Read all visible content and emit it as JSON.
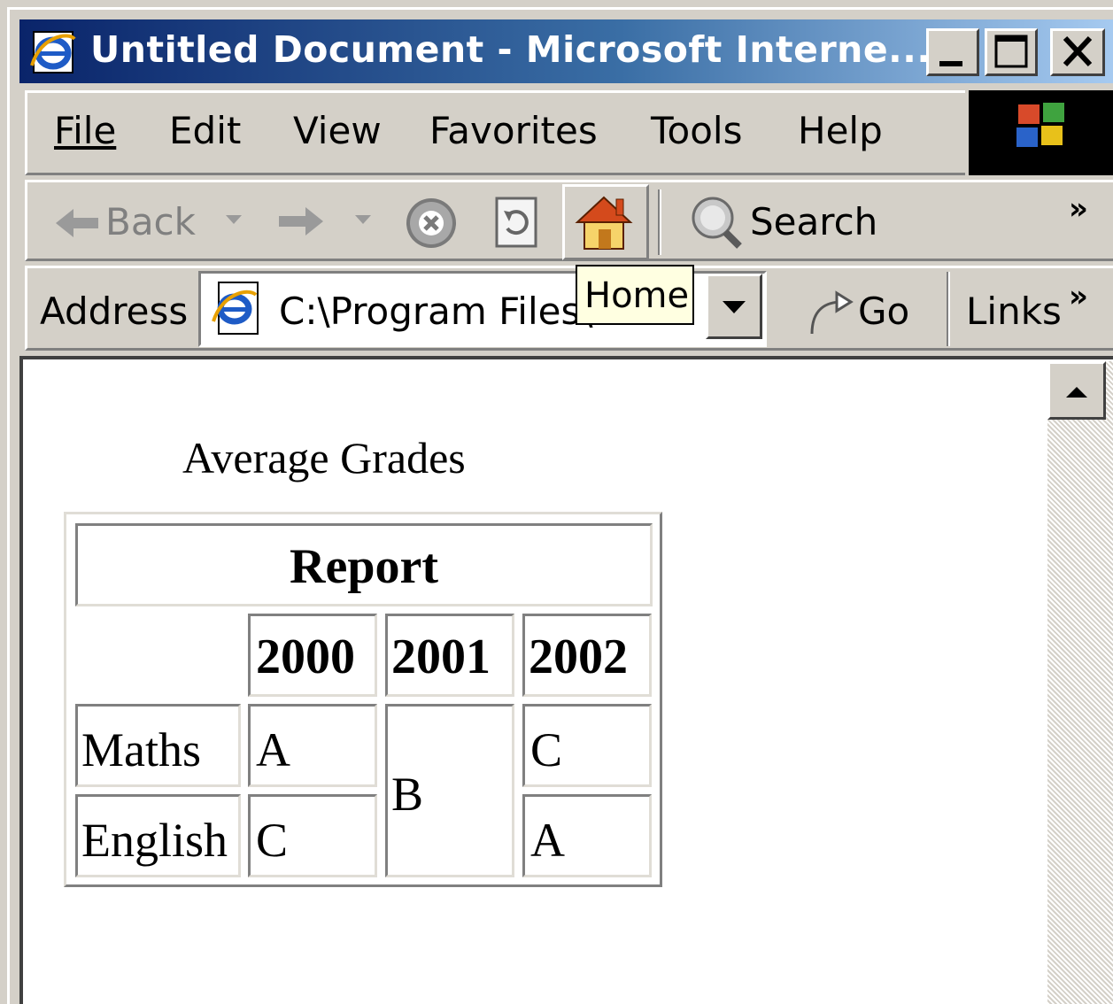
{
  "window": {
    "title": "Untitled Document - Microsoft Interne..."
  },
  "menu": {
    "file": "File",
    "edit": "Edit",
    "view": "View",
    "favorites": "Favorites",
    "tools": "Tools",
    "help": "Help"
  },
  "toolbar": {
    "back": "Back",
    "search": "Search",
    "overflow": "»"
  },
  "address": {
    "label": "Address",
    "value": "C:\\Program Files\\",
    "go": "Go",
    "links": "Links",
    "overflow": "»"
  },
  "tooltip": {
    "text": "Home"
  },
  "page": {
    "heading": "Average Grades",
    "table": {
      "caption": "Report",
      "years": [
        "2000",
        "2001",
        "2002"
      ],
      "rows": [
        {
          "subject": "Maths",
          "grades": [
            "A",
            "B",
            "C"
          ]
        },
        {
          "subject": "English",
          "grades": [
            "C",
            "B",
            "A"
          ]
        }
      ]
    }
  },
  "colors": {
    "titlebar_start": "#0a246a",
    "titlebar_end": "#a6caf0",
    "chrome": "#d4d0c8",
    "tooltip_bg": "#ffffe1"
  }
}
